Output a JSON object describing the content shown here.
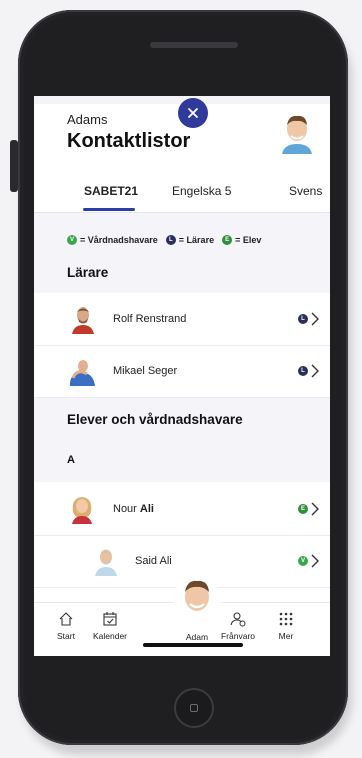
{
  "header": {
    "owner": "Adams",
    "title": "Kontaktlistor"
  },
  "tabs": [
    {
      "label": "SABET21",
      "active": true
    },
    {
      "label": "Engelska 5",
      "active": false
    },
    {
      "label": "Svens",
      "active": false
    }
  ],
  "legend": {
    "guardian": {
      "badge": "V",
      "label": "= Vårdnadshavare",
      "color": "#3aa84a"
    },
    "teacher": {
      "badge": "L",
      "label": "= Lärare",
      "color": "#2a2d5e"
    },
    "student": {
      "badge": "E",
      "label": "= Elev",
      "color": "#2f8f3a"
    }
  },
  "sections": {
    "teachers_title": "Lärare",
    "students_title": "Elever och vårdnadshavare",
    "letter": "A"
  },
  "teachers": [
    {
      "name": "Rolf Renstrand",
      "role": "L"
    },
    {
      "name": "Mikael Seger",
      "role": "L"
    }
  ],
  "students": [
    {
      "first": "Nour",
      "last": "Ali",
      "role": "E"
    },
    {
      "first": "Said",
      "last": "Ali",
      "role": "V"
    }
  ],
  "nav": {
    "start": "Start",
    "calendar": "Kalender",
    "profile": "Adam",
    "absence": "Frånvaro",
    "more": "Mer"
  },
  "colors": {
    "accent": "#2b3ea8",
    "close_button": "#2f3a9a"
  }
}
